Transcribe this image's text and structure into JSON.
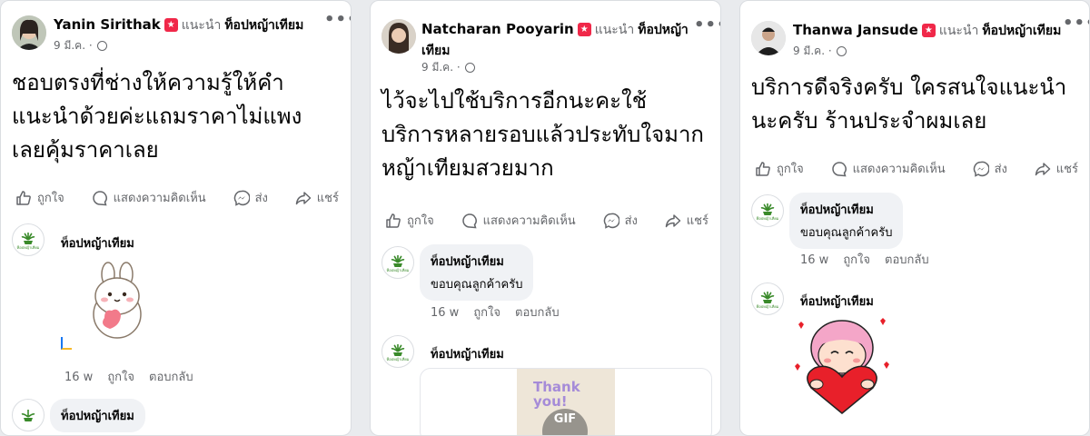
{
  "actions": {
    "like": "ถูกใจ",
    "comment": "แสดงความคิดเห็น",
    "send": "ส่ง",
    "share": "แชร์"
  },
  "recommend": "แนะนำ",
  "page_name": "ท็อปหญ้าเทียม",
  "logo_caption": "ท็อปหญ้าเทียม",
  "comment_meta": {
    "time": "16 w",
    "like": "ถูกใจ",
    "reply": "ตอบกลับ"
  },
  "more": "•••",
  "badge_icon": "recommend-star-icon",
  "colors": {
    "badge": "#f02849",
    "secondary_text": "#65676b",
    "bubble": "#f0f2f5",
    "logo_green": "#3a8a2a"
  },
  "posts": [
    {
      "author": "Yanin Sirithak",
      "date": "9 มี.ค.",
      "text": "ชอบตรงที่ช่างให้ความรู้ให้คำแนะนำด้วยค่ะแถมราคาไม่แพงเลยคุ้มราคาเลย",
      "comment_text": "",
      "sticker": "bunny-holding-heart-sticker"
    },
    {
      "author": "Natcharan Pooyarin",
      "date": "9 มี.ค.",
      "text": "ไว้จะไปใช้บริการอีกนะคะใช้บริการหลายรอบแล้วประทับใจมาก หญ้าเทียมสวยมาก",
      "comment_text": "ขอบคุณลูกค้าครับ",
      "gif_text": "Thank you!",
      "gif_badge": "GIF"
    },
    {
      "author": "Thanwa Jansude",
      "date": "9 มี.ค.",
      "text": "บริการดีจริงครับ ใครสนใจแนะนำนะครับ ร้านประจำผมเลย",
      "comment_text": "ขอบคุณลูกค้าครับ",
      "sticker": "girl-hugging-heart-sticker"
    }
  ]
}
